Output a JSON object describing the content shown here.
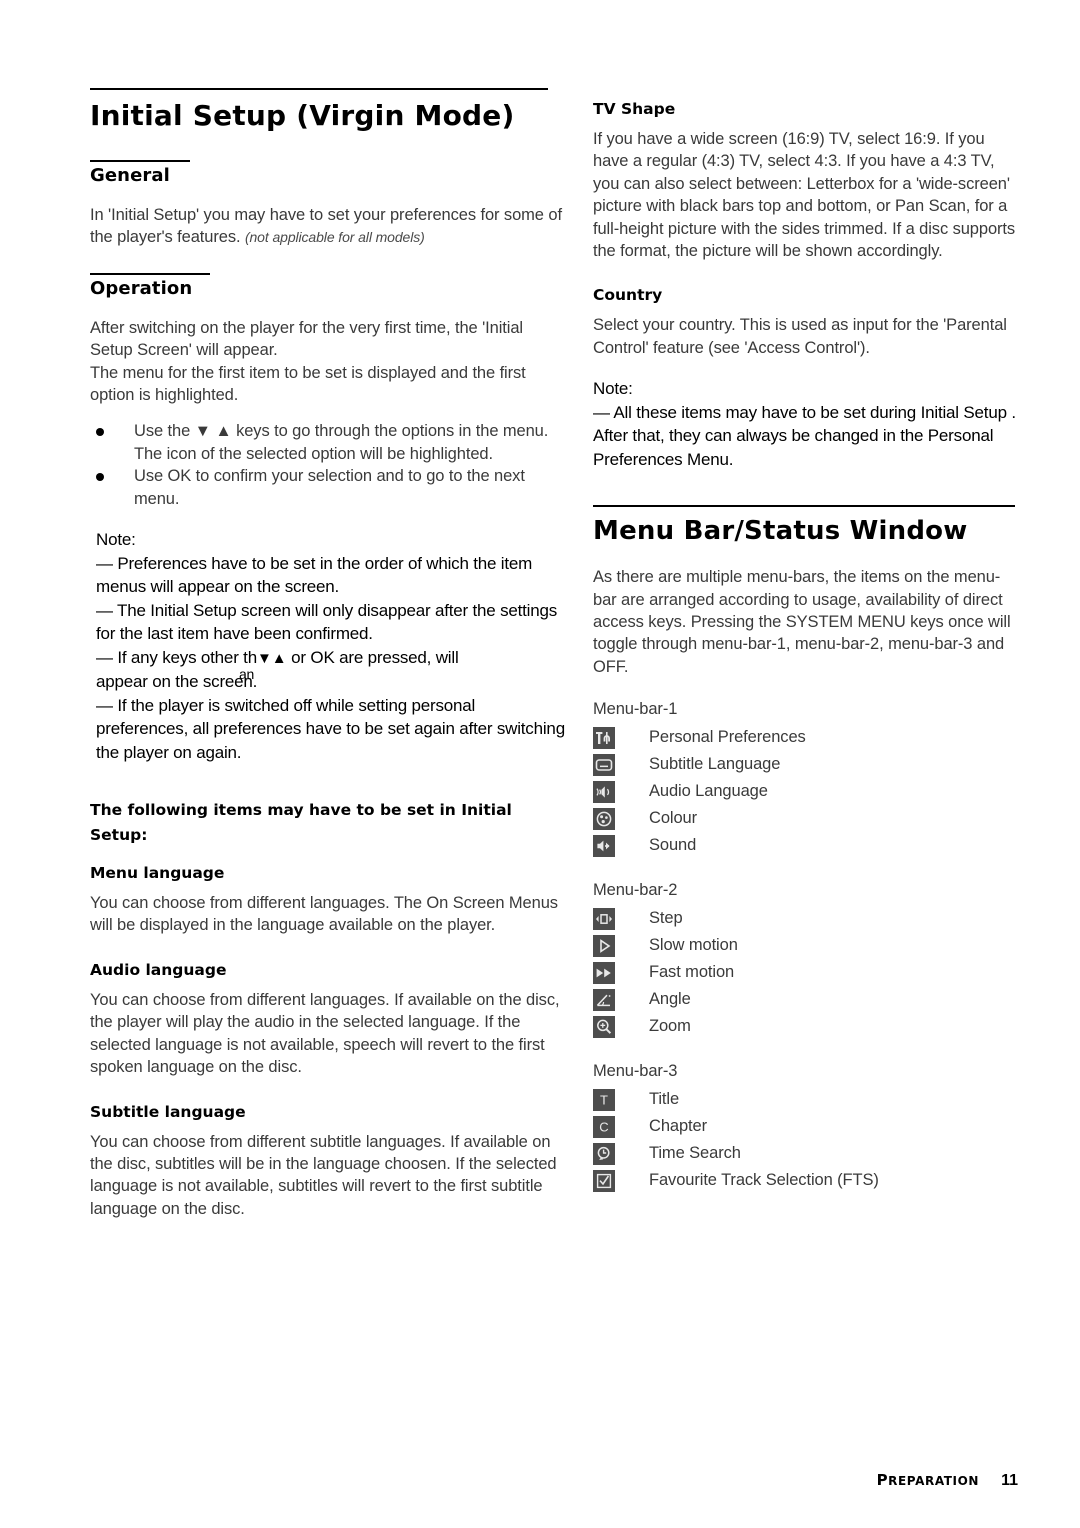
{
  "page": {
    "footer_section": "PREPARATION",
    "footer_page_number": "11"
  },
  "left_column": {
    "title": "Initial Setup (Virgin Mode)",
    "general": {
      "heading": "General",
      "paragraph": "In 'Initial Setup' you may have to set your preferences for some of the player's features.",
      "paragraph_italic": "(not applicable for all models)"
    },
    "operation": {
      "heading": "Operation",
      "paragraph_1": "After switching on the player for the very first time, the 'Initial Setup Screen' will appear.",
      "paragraph_2": "The menu for the first item to be set is displayed and the first option is highlighted.",
      "bullets": [
        "Use the ▼ ▲ keys to go through the options in the menu. The icon of the selected option will be highlighted.",
        "Use OK to confirm your selection and to go to the next menu."
      ],
      "note_label": "Note:",
      "notes": [
        "—  Preferences have to be set in the order of which the item menus will appear on the screen.",
        "—  The Initial Setup  screen will only disappear after the settings for the last item have been confirmed.",
        "—  If any keys other than ▼▲ or OK are pressed, will appear on the screen.",
        "—  If the player is switched off while setting personal preferences, all preferences have to be set again after switching the player on again."
      ],
      "note_3_part_a": "—  If any keys other th",
      "note_3_overlap": "an",
      "note_3_arrows": "▼▲",
      "note_3_part_b": " or OK are pressed, will",
      "note_3_line2": "appear on the screen."
    },
    "following_items": {
      "heading": "The following items may have to be set in Initial Setup:"
    },
    "menu_language": {
      "heading": "Menu language",
      "paragraph": "You can choose from different languages. The On Screen Menus will be displayed in the language available on the player."
    },
    "audio_language": {
      "heading": "Audio language",
      "paragraph": "You can choose from different languages. If available on the disc, the player will play the audio in the selected language. If the selected language is not available, speech will revert to the first spoken language on the disc."
    },
    "subtitle_language": {
      "heading": "Subtitle language",
      "paragraph": "You can choose from different subtitle languages. If available on the disc, subtitles will be in the language choosen. If the selected language is not available, subtitles will revert to the first subtitle language on the disc."
    }
  },
  "right_column": {
    "tv_shape": {
      "heading": "TV Shape",
      "paragraph": "If you have a wide screen (16:9) TV, select 16:9. If you have a regular (4:3) TV, select 4:3. If you have a 4:3 TV, you can also select between: Letterbox for a 'wide-screen' picture with black bars top and bottom, or Pan Scan, for a full-height picture with the sides trimmed. If a disc supports the format, the picture will be shown accordingly."
    },
    "country": {
      "heading": "Country",
      "paragraph": "Select your country. This is used as input for the 'Parental Control' feature (see 'Access Control').",
      "note_label": "Note:",
      "note": "—  All these items may have to be set during  Initial Setup . After that, they can always be changed in the Personal Preferences Menu."
    },
    "menu_bar": {
      "title": "Menu Bar/Status Window",
      "paragraph": "As there are multiple menu-bars, the items on the menu-bar are arranged according to usage, availability of direct access keys. Pressing the SYSTEM MENU keys once will toggle through menu-bar-1, menu-bar-2, menu-bar-3 and OFF.",
      "groups": [
        {
          "label": "Menu-bar-1",
          "items": [
            {
              "icon": "personal-preferences-icon",
              "label": "Personal Preferences"
            },
            {
              "icon": "subtitle-language-icon",
              "label": "Subtitle Language"
            },
            {
              "icon": "audio-language-icon",
              "label": "Audio Language"
            },
            {
              "icon": "colour-icon",
              "label": "Colour"
            },
            {
              "icon": "sound-icon",
              "label": "Sound"
            }
          ]
        },
        {
          "label": "Menu-bar-2",
          "items": [
            {
              "icon": "step-icon",
              "label": "Step"
            },
            {
              "icon": "slow-motion-icon",
              "label": "Slow motion"
            },
            {
              "icon": "fast-motion-icon",
              "label": "Fast motion"
            },
            {
              "icon": "angle-icon",
              "label": "Angle"
            },
            {
              "icon": "zoom-icon",
              "label": "Zoom"
            }
          ]
        },
        {
          "label": "Menu-bar-3",
          "items": [
            {
              "icon": "title-icon",
              "label": "Title"
            },
            {
              "icon": "chapter-icon",
              "label": "Chapter"
            },
            {
              "icon": "time-search-icon",
              "label": "Time Search"
            },
            {
              "icon": "fts-icon",
              "label": "Favourite Track Selection (FTS)"
            }
          ]
        }
      ]
    }
  },
  "colors": {
    "body_text": "#3a3a3a",
    "heading_text": "#000000",
    "icon_background": "#4d4d4d",
    "icon_glyph": "#e8e8e8"
  }
}
